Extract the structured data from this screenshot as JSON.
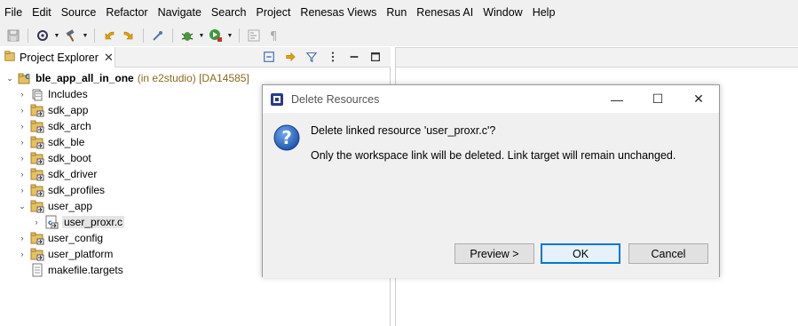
{
  "menubar": {
    "items": [
      "File",
      "Edit",
      "Source",
      "Refactor",
      "Navigate",
      "Search",
      "Project",
      "Renesas Views",
      "Run",
      "Renesas AI",
      "Window",
      "Help"
    ]
  },
  "toolbar": {
    "icons": [
      "save-icon",
      "build-config-icon",
      "hammer-build-icon",
      "back-icon",
      "forward-icon",
      "debug-icon",
      "bug-debug-icon",
      "run-icon",
      "terminal-icon",
      "pilcrow-icon"
    ]
  },
  "explorer": {
    "tab_label": "Project Explorer",
    "tree": [
      {
        "label": "ble_app_all_in_one",
        "extra": "(in e2studio) [DA14585]",
        "expanded": true,
        "level": 0,
        "icon": "project-icon"
      },
      {
        "label": "Includes",
        "expanded": false,
        "level": 1,
        "icon": "includes-icon"
      },
      {
        "label": "sdk_app",
        "expanded": false,
        "level": 1,
        "icon": "linked-folder-icon"
      },
      {
        "label": "sdk_arch",
        "expanded": false,
        "level": 1,
        "icon": "linked-folder-icon"
      },
      {
        "label": "sdk_ble",
        "expanded": false,
        "level": 1,
        "icon": "linked-folder-icon"
      },
      {
        "label": "sdk_boot",
        "expanded": false,
        "level": 1,
        "icon": "linked-folder-icon"
      },
      {
        "label": "sdk_driver",
        "expanded": false,
        "level": 1,
        "icon": "linked-folder-icon"
      },
      {
        "label": "sdk_profiles",
        "expanded": false,
        "level": 1,
        "icon": "linked-folder-icon"
      },
      {
        "label": "user_app",
        "expanded": true,
        "level": 1,
        "icon": "linked-folder-icon"
      },
      {
        "label": "user_proxr.c",
        "expanded": false,
        "level": 2,
        "icon": "c-file-icon",
        "selected": true
      },
      {
        "label": "user_config",
        "expanded": false,
        "level": 1,
        "icon": "linked-folder-icon"
      },
      {
        "label": "user_platform",
        "expanded": false,
        "level": 1,
        "icon": "linked-folder-icon"
      },
      {
        "label": "makefile.targets",
        "expanded": false,
        "level": 1,
        "icon": "text-file-icon",
        "leaf": true
      }
    ]
  },
  "dialog": {
    "title": "Delete Resources",
    "message": "Delete linked resource 'user_proxr.c'?",
    "detail": "Only the workspace link will be deleted. Link target will remain unchanged.",
    "preview_label": "Preview >",
    "ok_label": "OK",
    "cancel_label": "Cancel"
  },
  "colors": {
    "accent": "#0078d7",
    "project_extra": "#8b6a1e",
    "chrome": "#f0f0f0"
  }
}
